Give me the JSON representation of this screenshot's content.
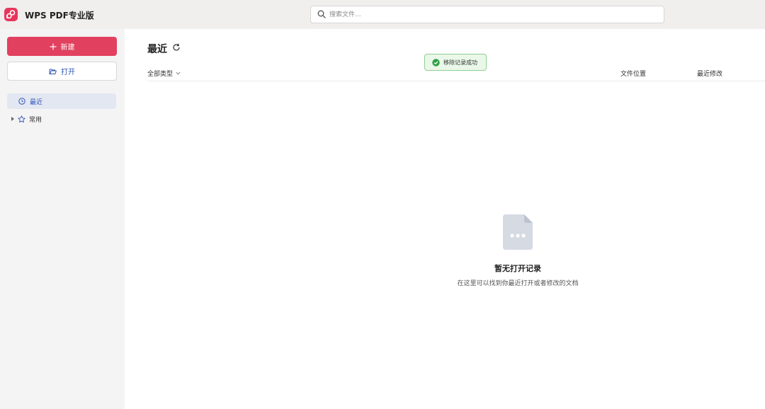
{
  "titlebar": {
    "app_title": "WPS PDF专业版",
    "logo_icon": "wps-pdf-logo-icon",
    "brand_color": "#e7365b"
  },
  "search": {
    "placeholder": "搜索文件...",
    "value": "",
    "icon": "search-icon"
  },
  "sidebar": {
    "new_label": "新建",
    "open_label": "打开",
    "items": [
      {
        "label": "最近",
        "icon": "clock-icon",
        "active": true
      },
      {
        "label": "常用",
        "icon": "star-icon",
        "active": false
      }
    ]
  },
  "main": {
    "title": "最近",
    "filter_label": "全部类型",
    "columns": [
      "文件位置",
      "最近修改"
    ],
    "toast": "移除记录成功",
    "empty": {
      "title": "暂无打开记录",
      "description": "在这里可以找到你最近打开或者修改的文档"
    }
  }
}
